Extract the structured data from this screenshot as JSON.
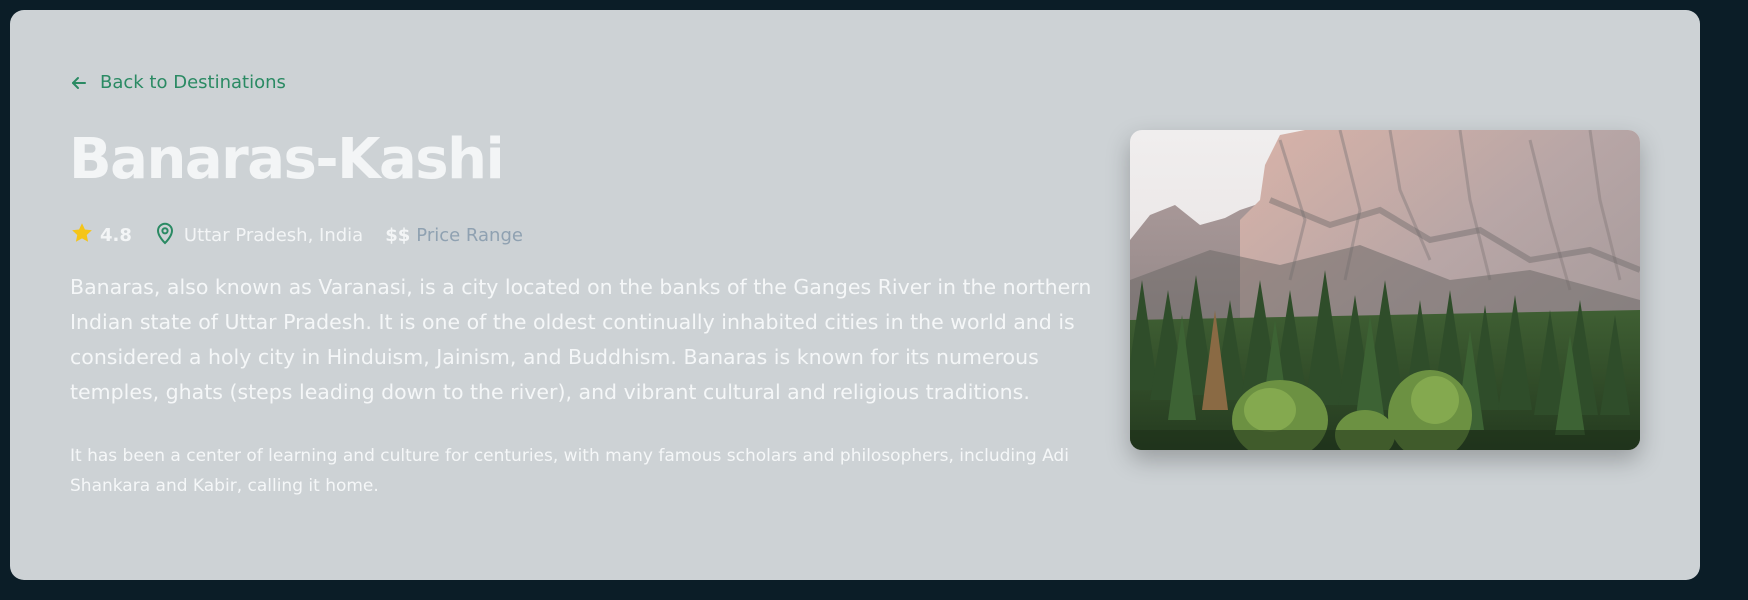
{
  "nav": {
    "back_label": "Back to Destinations",
    "back_icon": "arrow-left-icon"
  },
  "destination": {
    "name": "Banaras-Kashi",
    "rating": "4.8",
    "rating_icon": "star-icon",
    "location": "Uttar Pradesh, India",
    "location_icon": "map-pin-icon",
    "price_symbol": "$$",
    "price_label": "Price Range",
    "description": "Banaras, also known as Varanasi, is a city located on the banks of the Ganges River in the northern Indian state of Uttar Pradesh. It is one of the oldest continually inhabited cities in the world and is considered a holy city in Hinduism, Jainism, and Buddhism. Banaras is known for its numerous temples, ghats (steps leading down to the river), and vibrant cultural and religious traditions.",
    "description_secondary": "It has been a center of learning and culture for centuries, with many famous scholars and philosophers, including Adi Shankara and Kabir, calling it home."
  },
  "colors": {
    "page_background": "#0b1d27",
    "card_background": "#cdd2d5",
    "accent": "#2a8a63",
    "star": "#f5c518",
    "title_text": "#f3f5f6",
    "muted_text": "#8fa1b1"
  }
}
